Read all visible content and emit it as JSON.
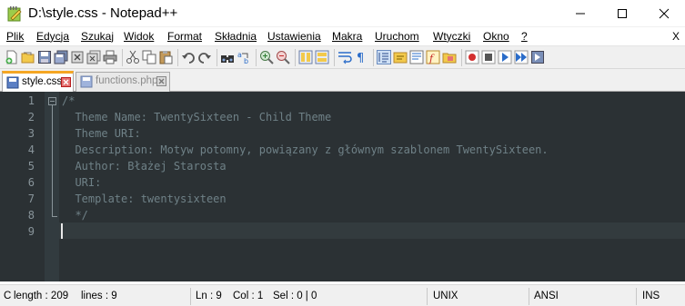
{
  "window": {
    "title": "D:\\style.css - Notepad++",
    "close_glyph": "X"
  },
  "menu": [
    "Plik",
    "Edycja",
    "Szukaj",
    "Widok",
    "Format",
    "Składnia",
    "Ustawienia",
    "Makra",
    "Uruchom",
    "Wtyczki",
    "Okno",
    "?"
  ],
  "tabs": [
    {
      "label": "style.css",
      "active": true
    },
    {
      "label": "functions.php",
      "active": false
    }
  ],
  "editor": {
    "lines": [
      {
        "num": "1",
        "text": "/*"
      },
      {
        "num": "2",
        "text": "  Theme Name: TwentySixteen - Child Theme"
      },
      {
        "num": "3",
        "text": "  Theme URI:"
      },
      {
        "num": "4",
        "text": "  Description: Motyw potomny, powiązany z głównym szablonem TwentySixteen."
      },
      {
        "num": "5",
        "text": "  Author: Błażej Starosta"
      },
      {
        "num": "6",
        "text": "  URI:"
      },
      {
        "num": "7",
        "text": "  Template: twentysixteen"
      },
      {
        "num": "8",
        "text": "  */"
      },
      {
        "num": "9",
        "text": ""
      }
    ],
    "colors": {
      "background": "#2b3134",
      "comment": "#6f8187",
      "line_number": "#88949a"
    }
  },
  "status": {
    "lang": "C",
    "length": "length : 209",
    "lines": "lines : 9",
    "ln": "Ln : 9",
    "col": "Col : 1",
    "sel": "Sel : 0 | 0",
    "eol": "UNIX",
    "encoding": "ANSI",
    "mode": "INS"
  },
  "toolbar_icons": [
    "new-file-icon",
    "open-file-icon",
    "save-icon",
    "save-all-icon",
    "close-icon",
    "close-all-icon",
    "print-icon",
    "cut-icon",
    "copy-icon",
    "paste-icon",
    "undo-icon",
    "redo-icon",
    "find-icon",
    "replace-icon",
    "zoom-in-icon",
    "zoom-out-icon",
    "sync-vertical-icon",
    "sync-horizontal-icon",
    "word-wrap-icon",
    "show-all-chars-icon",
    "indent-guide-icon",
    "language-icon",
    "doc-map-icon",
    "function-list-icon",
    "folder-workspace-icon",
    "record-macro-icon",
    "stop-macro-icon",
    "play-macro-icon",
    "run-macro-multiple-icon",
    "save-macro-icon"
  ]
}
